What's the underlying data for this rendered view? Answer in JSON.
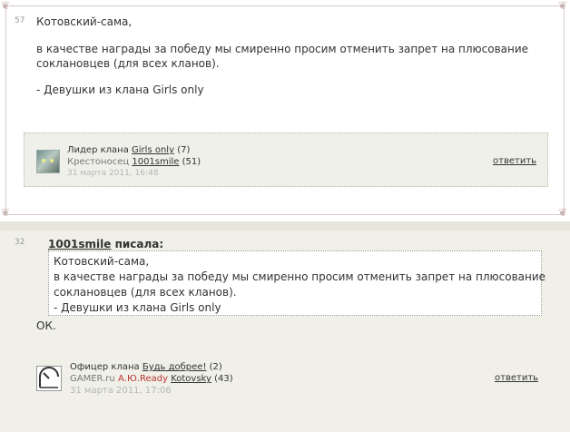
{
  "post1": {
    "number": "57",
    "lines": [
      "Котовский-сама,",
      "в качестве награды за победу мы смиренно просим отменить запрет на плюсование",
      "сoклановцев (для всех кланов).",
      "- Девушки из клана Girls only"
    ],
    "signature": {
      "rank_prefix": "Лидер клана",
      "clan": "Girls only",
      "clan_count": "(7)",
      "title": "Крестоносец",
      "user": "1001smile",
      "user_count": "(51)",
      "date": "31 марта 2011, 16:48",
      "reply": "ответить"
    }
  },
  "post2": {
    "number": "32",
    "quote_author": "1001smile",
    "quote_suffix": "писала:",
    "quote_lines": [
      "Котовский-сама,",
      "в качестве награды за победу мы смиренно просим отменить запрет на плюсование",
      "сoклановцев (для всех кланов).",
      "- Девушки из клана Girls only"
    ],
    "text": "ОК.",
    "signature": {
      "rank_prefix": "Офицер клана",
      "clan": "Будь добрее!",
      "clan_count": "(2)",
      "site": "GAMER.ru",
      "site_rank": "А.Ю.Ready",
      "user": "Kotovsky",
      "user_count": "(43)",
      "date": "31 марта 2011, 17:06",
      "reply": "ответить"
    }
  }
}
